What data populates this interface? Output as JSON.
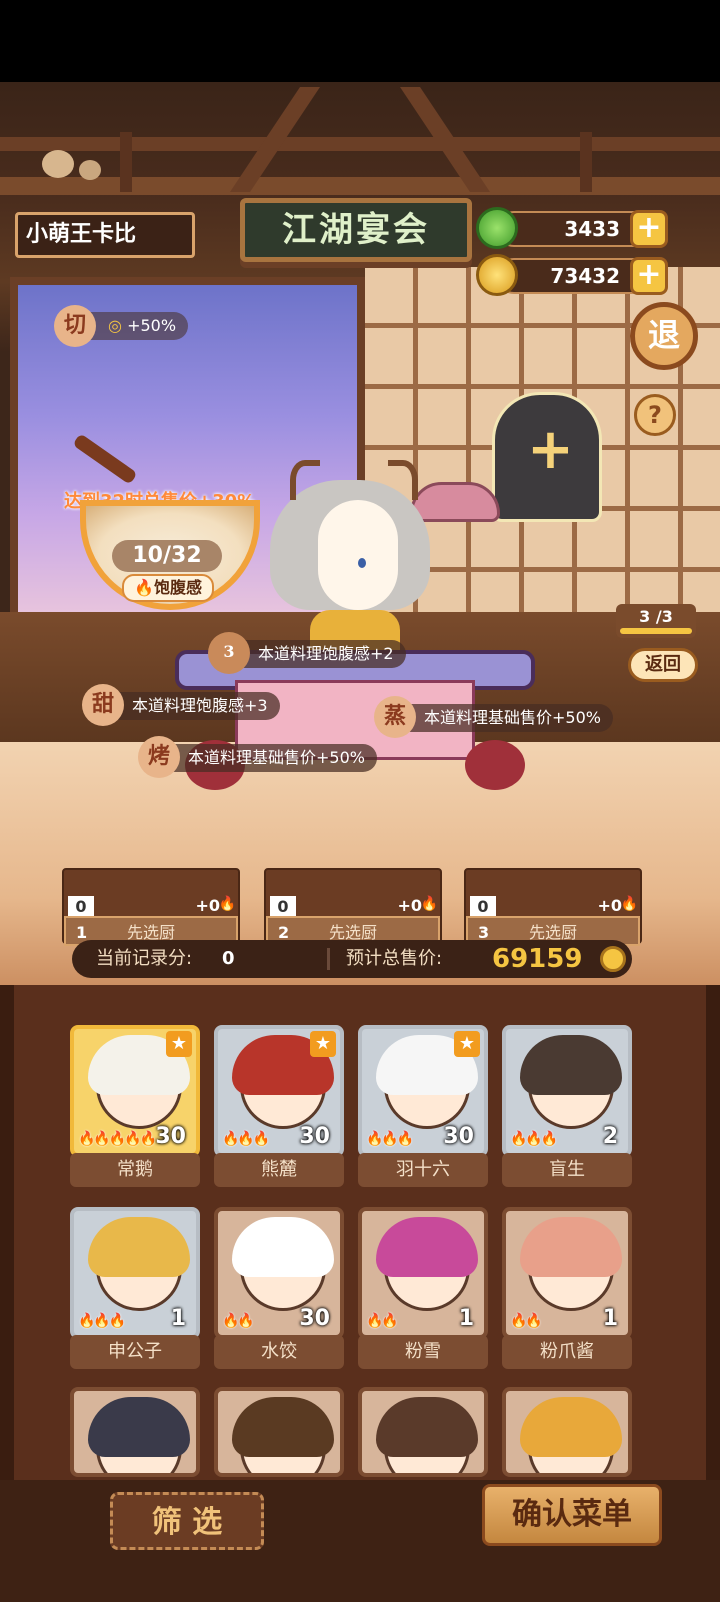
{
  "player_name": "小萌王卡比",
  "banner_title": "江湖宴会",
  "currencies": [
    {
      "name": "jade",
      "value": "3433",
      "icon": "jade-icon"
    },
    {
      "name": "coin",
      "value": "73432",
      "icon": "coin-icon"
    }
  ],
  "buttons": {
    "exit": "退",
    "help": "?",
    "back": "返回",
    "filter": "筛 选",
    "confirm": "确认菜单"
  },
  "progress_counter": "3 /3",
  "skill_badge": {
    "char": "切",
    "bonus": "+50%"
  },
  "satiety": {
    "goal_text": "达到32时总售价+30%",
    "value": "10/32",
    "label": "饱腹感"
  },
  "effect_tags": [
    {
      "char": "3",
      "text": "本道料理饱腹感+2"
    },
    {
      "char": "甜",
      "text": "本道料理饱腹感+3"
    },
    {
      "char": "蒸",
      "text": "本道料理基础售价+50%"
    },
    {
      "char": "烤",
      "text": "本道料理基础售价+50%"
    }
  ],
  "slots": [
    {
      "index": "1",
      "count": "0",
      "bonus": "+0",
      "label": "先选厨"
    },
    {
      "index": "2",
      "count": "0",
      "bonus": "+0",
      "label": "先选厨"
    },
    {
      "index": "3",
      "count": "0",
      "bonus": "+0",
      "label": "先选厨"
    }
  ],
  "score": {
    "record_label": "当前记录分:",
    "record_value": "0",
    "price_label": "预计总售价:",
    "price_value": "69159"
  },
  "chefs": [
    {
      "name": "常鹅",
      "level": "30",
      "flames": 5,
      "frame": "gold",
      "star": true,
      "hair": "#f4f2ea"
    },
    {
      "name": "熊麓",
      "level": "30",
      "flames": 3,
      "frame": "silver",
      "star": true,
      "hair": "#b8352a"
    },
    {
      "name": "羽十六",
      "level": "30",
      "flames": 3,
      "frame": "silver",
      "star": true,
      "hair": "#f6f6f6"
    },
    {
      "name": "盲生",
      "level": "2",
      "flames": 3,
      "frame": "silver",
      "star": false,
      "hair": "#4a3a32"
    },
    {
      "name": "申公子",
      "level": "1",
      "flames": 3,
      "frame": "silver",
      "star": false,
      "hair": "#e8b84a"
    },
    {
      "name": "水饺",
      "level": "30",
      "flames": 2,
      "frame": "brown",
      "star": false,
      "hair": "#ffffff"
    },
    {
      "name": "粉雪",
      "level": "1",
      "flames": 2,
      "frame": "brown",
      "star": false,
      "hair": "#c84a9a"
    },
    {
      "name": "粉爪酱",
      "level": "1",
      "flames": 2,
      "frame": "brown",
      "star": false,
      "hair": "#e8a08a"
    },
    {
      "name": "",
      "level": "",
      "flames": 0,
      "frame": "brown",
      "star": false,
      "hair": "#3a3a4a"
    },
    {
      "name": "",
      "level": "",
      "flames": 0,
      "frame": "brown",
      "star": false,
      "hair": "#5a3a22"
    },
    {
      "name": "",
      "level": "",
      "flames": 0,
      "frame": "brown",
      "star": false,
      "hair": "#5a3a2a"
    },
    {
      "name": "",
      "level": "",
      "flames": 0,
      "frame": "brown",
      "star": false,
      "hair": "#e8a83a"
    }
  ]
}
